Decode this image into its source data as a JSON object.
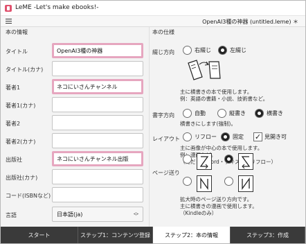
{
  "window": {
    "title": "LeME -Let's make ebooks!-"
  },
  "menubar": {
    "doc_title": "OpenAI3種の神器 (untitled.leme) ＊"
  },
  "left": {
    "section_title": "本の情報",
    "fields": [
      {
        "label": "タイトル",
        "value": "OpenAI3種の神器",
        "highlighted": true
      },
      {
        "label": "タイトル(カナ)",
        "value": "",
        "highlighted": false
      },
      {
        "label": "著者1",
        "value": "ネコにいさんチャンネル",
        "highlighted": true
      },
      {
        "label": "著者1(カナ)",
        "value": "",
        "highlighted": false
      },
      {
        "label": "著者2",
        "value": "",
        "highlighted": false
      },
      {
        "label": "著者2(カナ)",
        "value": "",
        "highlighted": false
      },
      {
        "label": "出版社",
        "value": "ネコにいさんチャンネル出版",
        "highlighted": true
      },
      {
        "label": "出版社(カナ)",
        "value": "",
        "highlighted": false
      },
      {
        "label": "コード(ISBNなど)",
        "value": "",
        "highlighted": false
      }
    ],
    "language": {
      "label": "言語",
      "value": "日本語(ja)"
    }
  },
  "right": {
    "section_title": "本の仕様",
    "binding": {
      "label": "綴じ方向",
      "options": [
        "右綴じ",
        "左綴じ"
      ],
      "selected": 1,
      "desc": [
        "主に横書きの本で使用します。",
        "例：英語の書籍・小説、技術書など。"
      ]
    },
    "writing": {
      "label": "書字方向",
      "options": [
        "自動",
        "縦書き",
        "横書き"
      ],
      "selected": 2,
      "desc": [
        "横書きにします(強制)。"
      ]
    },
    "layout": {
      "label": "レイアウト",
      "options": [
        "リフロー",
        "固定"
      ],
      "selected": 1,
      "checkbox_label": "見開き可",
      "checkbox_checked": true,
      "desc": [
        "主に画像が中心の本で使用します。",
        "例：漫画など。",
        "（ただし、Word・テキストはリフロー）"
      ]
    },
    "paging": {
      "label": "ページ送り",
      "selected": 1,
      "desc": [
        "拡大時のページ送り方向です。",
        "主に横書きの漫画で使用します。",
        "（Kindleのみ）"
      ]
    }
  },
  "tabs": [
    {
      "label": "スタート",
      "active": false
    },
    {
      "label": "ステップ1：コンテンツ登録",
      "active": false
    },
    {
      "label": "ステップ2：本の情報",
      "active": true
    },
    {
      "label": "ステップ3：作成",
      "active": false
    }
  ]
}
